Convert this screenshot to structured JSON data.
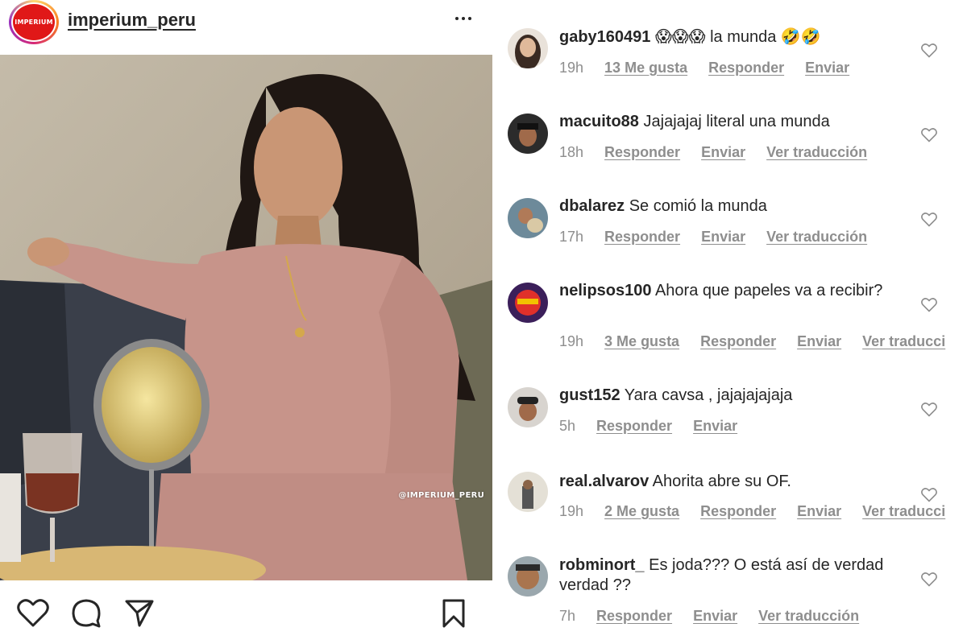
{
  "post": {
    "username": "imperium_peru",
    "avatar_text": "IMPERIUM",
    "watermark": "@IMPERIUM_PERU",
    "icons": {
      "more": "more-options-icon",
      "like": "heart-icon",
      "comment": "comment-icon",
      "share": "share-icon",
      "save": "bookmark-icon"
    }
  },
  "comments": [
    {
      "user": "gaby160491",
      "text": "😱😱😱 la munda 🤣🤣",
      "time": "19h",
      "actions": [
        "13 Me gusta",
        "Responder",
        "Enviar"
      ]
    },
    {
      "user": "macuito88",
      "text": "Jajajajaj literal una munda",
      "time": "18h",
      "actions": [
        "Responder",
        "Enviar",
        "Ver traducción"
      ]
    },
    {
      "user": "dbalarez",
      "text": "Se comió la munda",
      "time": "17h",
      "actions": [
        "Responder",
        "Enviar",
        "Ver traducción"
      ]
    },
    {
      "user": "nelipsos100",
      "text": "Ahora que papeles va a recibir?",
      "time": "19h",
      "actions": [
        "3 Me gusta",
        "Responder",
        "Enviar",
        "Ver traducci"
      ]
    },
    {
      "user": "gust152",
      "text": "Yara cavsa , jajajajajaja",
      "time": "5h",
      "actions": [
        "Responder",
        "Enviar"
      ]
    },
    {
      "user": "real.alvarov",
      "text": "Ahorita abre su OF.",
      "time": "19h",
      "actions": [
        "2 Me gusta",
        "Responder",
        "Enviar",
        "Ver traducci"
      ]
    },
    {
      "user": "robminort_",
      "text": "Es joda??? O está así de verdad verdad ??",
      "time": "7h",
      "actions": [
        "Responder",
        "Enviar",
        "Ver traducción"
      ]
    }
  ],
  "colors": {
    "text": "#262626",
    "secondary": "#8e8e8e",
    "brand_red": "#e01818"
  }
}
